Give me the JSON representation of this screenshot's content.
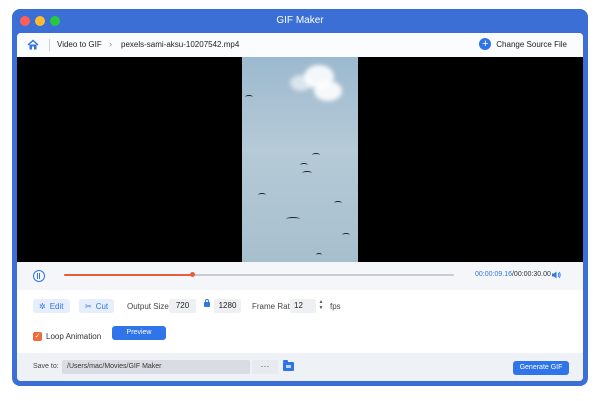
{
  "window": {
    "title": "GIF Maker",
    "traffic_lights": [
      "#ff5f57",
      "#febc2e",
      "#28c840"
    ]
  },
  "breadcrumb": {
    "home_icon": "home-icon",
    "section": "Video to GIF",
    "file": "pexels-sami-aksu-10207542.mp4",
    "change_source_label": "Change Source File",
    "change_source_icon": "plus-circle-icon"
  },
  "player": {
    "play_icon": "pause-icon",
    "progress": 0.33,
    "current_time": "00:00:09.16",
    "total_time": "/00:00:30.00",
    "volume_icon": "volume-icon"
  },
  "tools": {
    "edit_label": "Edit",
    "edit_icon": "wand-icon",
    "cut_label": "Cut",
    "cut_icon": "scissors-icon",
    "output_size_label": "Output Size:",
    "width": "720",
    "height": "1280",
    "lock_icon": "lock-icon",
    "frame_rate_label": "Frame Rate:",
    "frame_rate": "12",
    "fps_label": "fps",
    "loop_label": "Loop Animation",
    "loop_checked": true,
    "preview_label": "Preview"
  },
  "footer": {
    "save_to_label": "Save to:",
    "path": "/Users/mac/Movies/GIF Maker",
    "browse_label": "···",
    "folder_icon": "folder-icon",
    "generate_label": "Generate GIF"
  },
  "colors": {
    "accent": "#2f74e8",
    "progress": "#e85d3a",
    "frame": "#3b6fd6"
  }
}
